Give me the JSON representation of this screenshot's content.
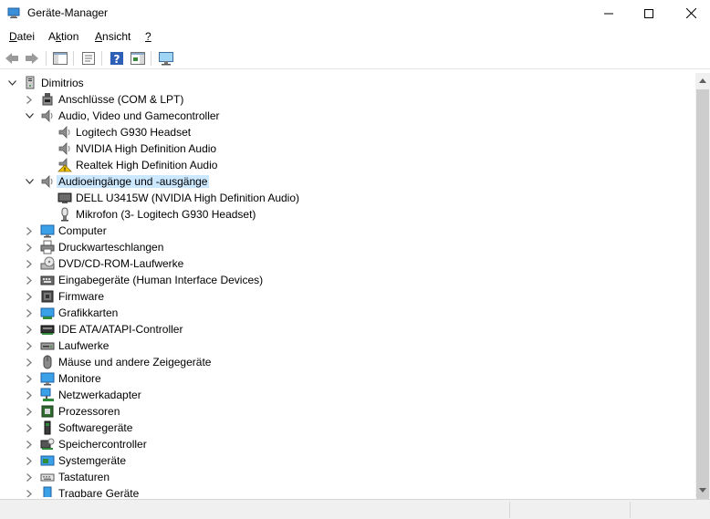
{
  "window": {
    "title": "Geräte-Manager"
  },
  "menu": [
    {
      "label": "Datei",
      "u": "D",
      "rest": "atei"
    },
    {
      "label": "Aktion",
      "u": "k",
      "pre": "A",
      "rest": "tion"
    },
    {
      "label": "Ansicht",
      "u": "n",
      "pre": "A",
      "rest": "sicht"
    },
    {
      "label": "?",
      "u": "?",
      "pre": "",
      "rest": ""
    }
  ],
  "toolbar": [
    "back-arrow-icon",
    "forward-arrow-icon",
    "show-hide-console-tree-icon",
    "properties-icon",
    "help-icon",
    "action-pane-icon",
    "scan-hardware-icon"
  ],
  "tree": {
    "root": "Dimitrios",
    "nodes": [
      {
        "label": "Anschlüsse (COM & LPT)",
        "level": 1,
        "state": "collapsed",
        "icon": "port-icon"
      },
      {
        "label": "Audio, Video und Gamecontroller",
        "level": 1,
        "state": "expanded",
        "icon": "speaker-icon"
      },
      {
        "label": "Logitech G930 Headset",
        "level": 2,
        "state": "leaf",
        "icon": "speaker-icon"
      },
      {
        "label": "NVIDIA High Definition Audio",
        "level": 2,
        "state": "leaf",
        "icon": "speaker-icon"
      },
      {
        "label": "Realtek High Definition Audio",
        "level": 2,
        "state": "leaf",
        "icon": "warning-speaker-icon"
      },
      {
        "label": "Audioeingänge und -ausgänge",
        "level": 1,
        "state": "expanded",
        "icon": "speaker-icon",
        "selected": true
      },
      {
        "label": "DELL U3415W (NVIDIA High Definition Audio)",
        "level": 2,
        "state": "leaf",
        "icon": "monitor-audio-icon"
      },
      {
        "label": "Mikrofon (3- Logitech G930 Headset)",
        "level": 2,
        "state": "leaf",
        "icon": "microphone-icon"
      },
      {
        "label": "Computer",
        "level": 1,
        "state": "collapsed",
        "icon": "computer-icon"
      },
      {
        "label": "Druckwarteschlangen",
        "level": 1,
        "state": "collapsed",
        "icon": "printer-icon"
      },
      {
        "label": "DVD/CD-ROM-Laufwerke",
        "level": 1,
        "state": "collapsed",
        "icon": "dvd-drive-icon"
      },
      {
        "label": "Eingabegeräte (Human Interface Devices)",
        "level": 1,
        "state": "collapsed",
        "icon": "hid-icon"
      },
      {
        "label": "Firmware",
        "level": 1,
        "state": "collapsed",
        "icon": "firmware-icon"
      },
      {
        "label": "Grafikkarten",
        "level": 1,
        "state": "collapsed",
        "icon": "display-adapter-icon"
      },
      {
        "label": "IDE ATA/ATAPI-Controller",
        "level": 1,
        "state": "collapsed",
        "icon": "ide-controller-icon"
      },
      {
        "label": "Laufwerke",
        "level": 1,
        "state": "collapsed",
        "icon": "disk-drive-icon"
      },
      {
        "label": "Mäuse und andere Zeigegeräte",
        "level": 1,
        "state": "collapsed",
        "icon": "mouse-icon"
      },
      {
        "label": "Monitore",
        "level": 1,
        "state": "collapsed",
        "icon": "monitor-icon"
      },
      {
        "label": "Netzwerkadapter",
        "level": 1,
        "state": "collapsed",
        "icon": "network-adapter-icon"
      },
      {
        "label": "Prozessoren",
        "level": 1,
        "state": "collapsed",
        "icon": "processor-icon"
      },
      {
        "label": "Softwaregeräte",
        "level": 1,
        "state": "collapsed",
        "icon": "software-device-icon"
      },
      {
        "label": "Speichercontroller",
        "level": 1,
        "state": "collapsed",
        "icon": "storage-controller-icon"
      },
      {
        "label": "Systemgeräte",
        "level": 1,
        "state": "collapsed",
        "icon": "system-device-icon"
      },
      {
        "label": "Tastaturen",
        "level": 1,
        "state": "collapsed",
        "icon": "keyboard-icon"
      },
      {
        "label": "Tragbare Geräte",
        "level": 1,
        "state": "collapsed",
        "icon": "portable-device-icon"
      }
    ]
  },
  "colors": {
    "selection": "#cce8ff",
    "thumb": "#cdcdcd",
    "scrollbar": "#f0f0f0"
  }
}
